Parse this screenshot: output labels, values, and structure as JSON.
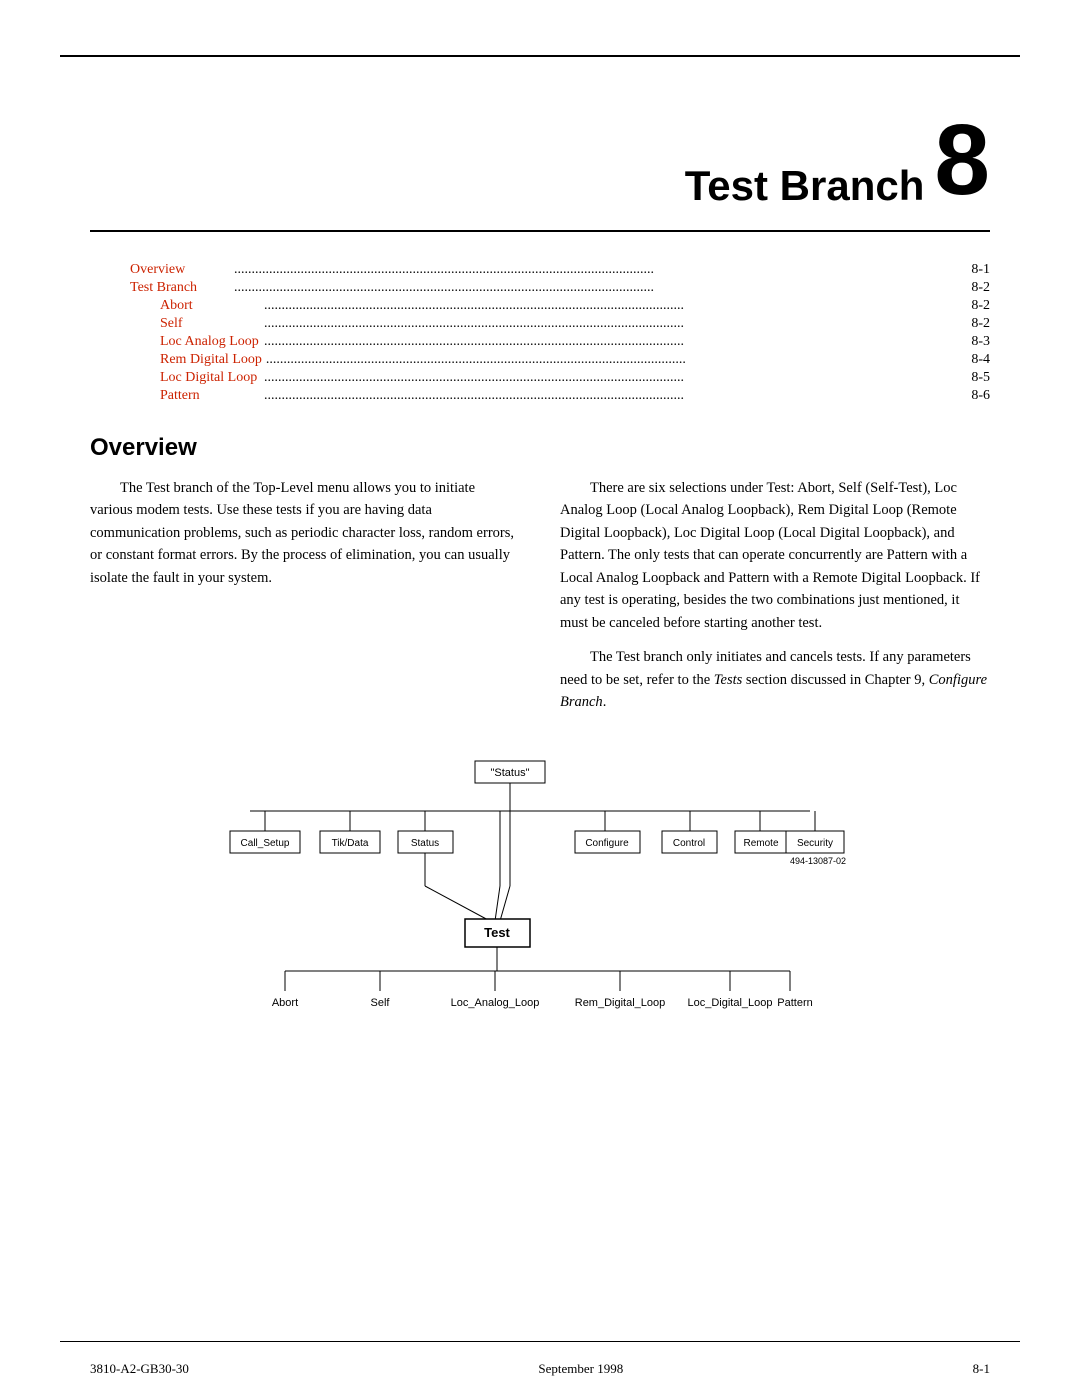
{
  "chapter": {
    "title": "Test Branch",
    "number": "8"
  },
  "toc": {
    "items": [
      {
        "label": "Overview",
        "dots": true,
        "page": "8-1",
        "indent": false
      },
      {
        "label": "Test Branch",
        "dots": true,
        "page": "8-2",
        "indent": false
      },
      {
        "label": "Abort",
        "dots": true,
        "page": "8-2",
        "indent": true
      },
      {
        "label": "Self",
        "dots": true,
        "page": "8-2",
        "indent": true
      },
      {
        "label": "Loc Analog Loop",
        "dots": true,
        "page": "8-3",
        "indent": true
      },
      {
        "label": "Rem Digital Loop",
        "dots": true,
        "page": "8-4",
        "indent": true
      },
      {
        "label": "Loc Digital Loop",
        "dots": true,
        "page": "8-5",
        "indent": true
      },
      {
        "label": "Pattern",
        "dots": true,
        "page": "8-6",
        "indent": true
      }
    ]
  },
  "overview": {
    "title": "Overview",
    "col_left": [
      "The Test branch of the Top-Level menu allows you to initiate various modem tests. Use these tests if you are having data communication problems, such as periodic character loss, random errors, or constant format errors. By the process of elimination, you can usually isolate the fault in your system."
    ],
    "col_right_p1": "There are six selections under Test: Abort, Self (Self-Test), Loc Analog Loop (Local Analog Loopback), Rem Digital Loop (Remote Digital Loopback), Loc Digital Loop (Local Digital Loopback), and Pattern. The only tests that can operate concurrently are Pattern with a Local Analog Loopback and Pattern with a Remote Digital Loopback. If any test is operating, besides the two combinations just mentioned, it must be canceled before starting another test.",
    "col_right_p2": "The Test branch only initiates and cancels tests. If any parameters need to be set, refer to the Tests section discussed in Chapter 9, Configure Branch."
  },
  "diagram": {
    "status_label": "\"Status\"",
    "menu_items": [
      "Call_Setup",
      "Tik/Data",
      "Status",
      "Configure",
      "Control",
      "Remote",
      "Security"
    ],
    "test_label": "Test",
    "sub_items": [
      "Abort",
      "Self",
      "Loc_Analog_Loop",
      "Rem_Digital_Loop",
      "Loc_Digital_Loop",
      "Pattern"
    ],
    "part_number": "494-13087-02"
  },
  "footer": {
    "left": "3810-A2-GB30-30",
    "center": "September 1998",
    "right": "8-1"
  }
}
